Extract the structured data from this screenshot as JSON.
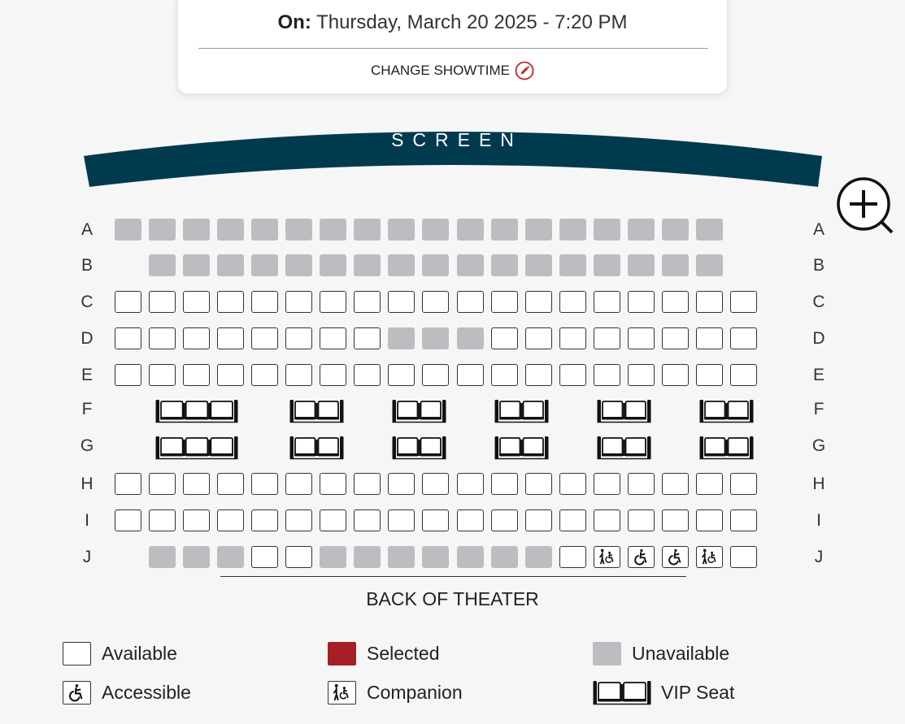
{
  "showtime": {
    "prefix": "On:",
    "value": "Thursday, March 20 2025 - 7:20 PM",
    "change_label": "CHANGE SHOWTIME"
  },
  "screen": {
    "label": "SCREEN"
  },
  "back_label": "BACK OF THEATER",
  "colors": {
    "screen": "#003a4f",
    "selected": "#a51f24",
    "unavailable": "#bcbdc0",
    "available": "#ffffff",
    "accent_edit": "#c0272d"
  },
  "rows": [
    {
      "label": "A",
      "seats": [
        "u",
        "u",
        "u",
        "u",
        "u",
        "u",
        "u",
        "u",
        "u",
        "u",
        "u",
        "u",
        "u",
        "u",
        "u",
        "u",
        "u",
        "u"
      ]
    },
    {
      "label": "B",
      "seats": [
        "-",
        "u",
        "u",
        "u",
        "u",
        "u",
        "u",
        "u",
        "u",
        "u",
        "u",
        "u",
        "u",
        "u",
        "u",
        "u",
        "u",
        "u"
      ]
    },
    {
      "label": "C",
      "seats": [
        "a",
        "a",
        "a",
        "a",
        "a",
        "a",
        "a",
        "a",
        "a",
        "a",
        "a",
        "a",
        "a",
        "a",
        "a",
        "a",
        "a",
        "a",
        "a"
      ]
    },
    {
      "label": "D",
      "seats": [
        "a",
        "a",
        "a",
        "a",
        "a",
        "a",
        "a",
        "a",
        "u",
        "u",
        "u",
        "a",
        "a",
        "a",
        "a",
        "a",
        "a",
        "a",
        "a"
      ]
    },
    {
      "label": "E",
      "seats": [
        "a",
        "a",
        "a",
        "a",
        "a",
        "a",
        "a",
        "a",
        "a",
        "a",
        "a",
        "a",
        "a",
        "a",
        "a",
        "a",
        "a",
        "a",
        "a"
      ]
    },
    {
      "label": "F",
      "vip_groups": [
        3,
        2,
        2,
        2,
        2,
        2
      ]
    },
    {
      "label": "G",
      "vip_groups": [
        3,
        2,
        2,
        2,
        2,
        2
      ]
    },
    {
      "label": "H",
      "seats": [
        "a",
        "a",
        "a",
        "a",
        "a",
        "a",
        "a",
        "a",
        "a",
        "a",
        "a",
        "a",
        "a",
        "a",
        "a",
        "a",
        "a",
        "a",
        "a"
      ]
    },
    {
      "label": "I",
      "seats": [
        "a",
        "a",
        "a",
        "a",
        "a",
        "a",
        "a",
        "a",
        "a",
        "a",
        "a",
        "a",
        "a",
        "a",
        "a",
        "a",
        "a",
        "a",
        "a"
      ]
    },
    {
      "label": "J",
      "seats": [
        "-",
        "u",
        "u",
        "u",
        "a",
        "a",
        "u",
        "u",
        "u",
        "u",
        "u",
        "u",
        "u",
        "a",
        "c",
        "w",
        "w",
        "c",
        "a"
      ]
    }
  ],
  "legend": [
    {
      "type": "available",
      "label": "Available"
    },
    {
      "type": "selected",
      "label": "Selected"
    },
    {
      "type": "unavailable",
      "label": "Unavailable"
    },
    {
      "type": "accessible",
      "label": "Accessible",
      "icon": "wheelchair-icon"
    },
    {
      "type": "companion",
      "label": "Companion",
      "icon": "companion-icon"
    },
    {
      "type": "vip",
      "label": "VIP Seat",
      "icon": "vip-seat-icon"
    }
  ]
}
